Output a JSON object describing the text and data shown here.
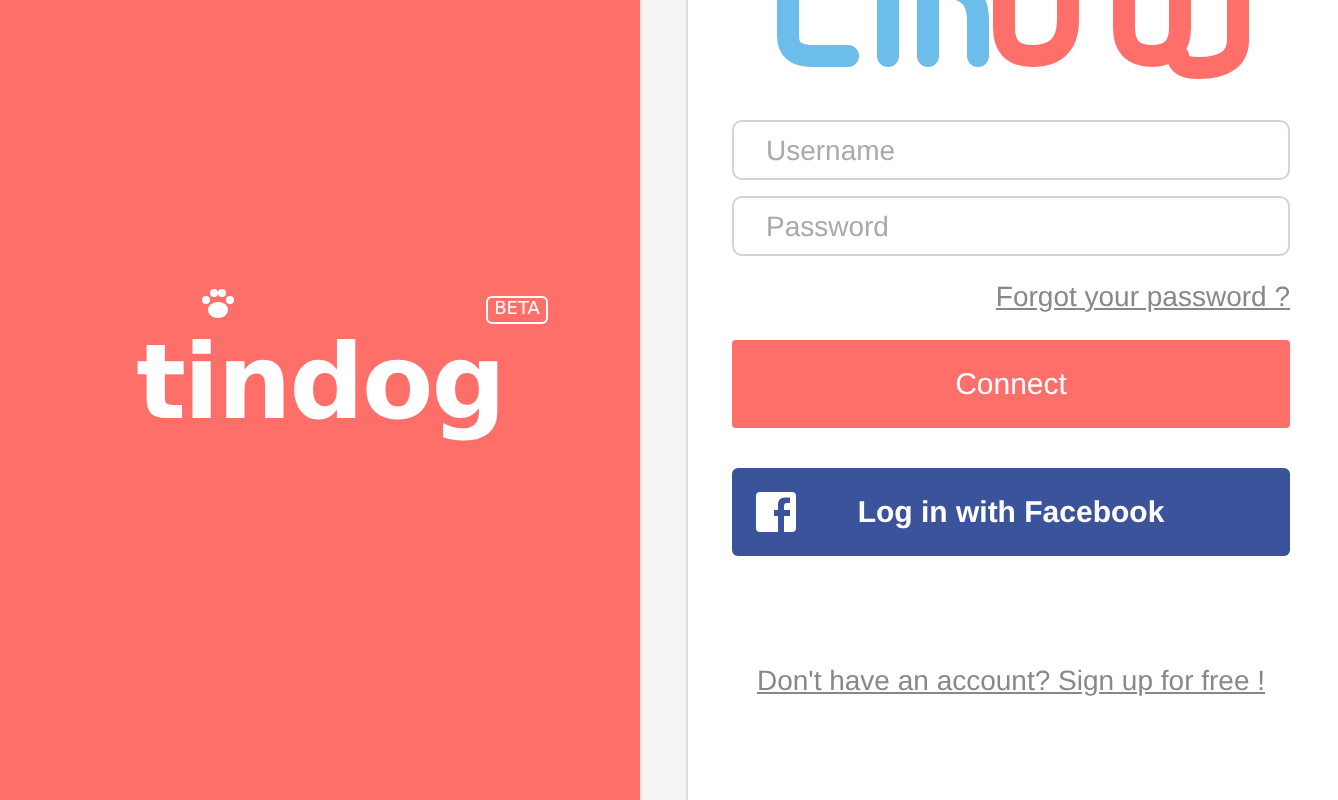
{
  "brand": {
    "name": "tindog",
    "badge": "BETA"
  },
  "form": {
    "username": {
      "placeholder": "Username"
    },
    "password": {
      "placeholder": "Password"
    },
    "forgot_link": "Forgot your password ?",
    "connect_button": "Connect",
    "facebook_button": "Log in with Facebook",
    "signup_link": "Don't have an account? Sign up for free !"
  }
}
